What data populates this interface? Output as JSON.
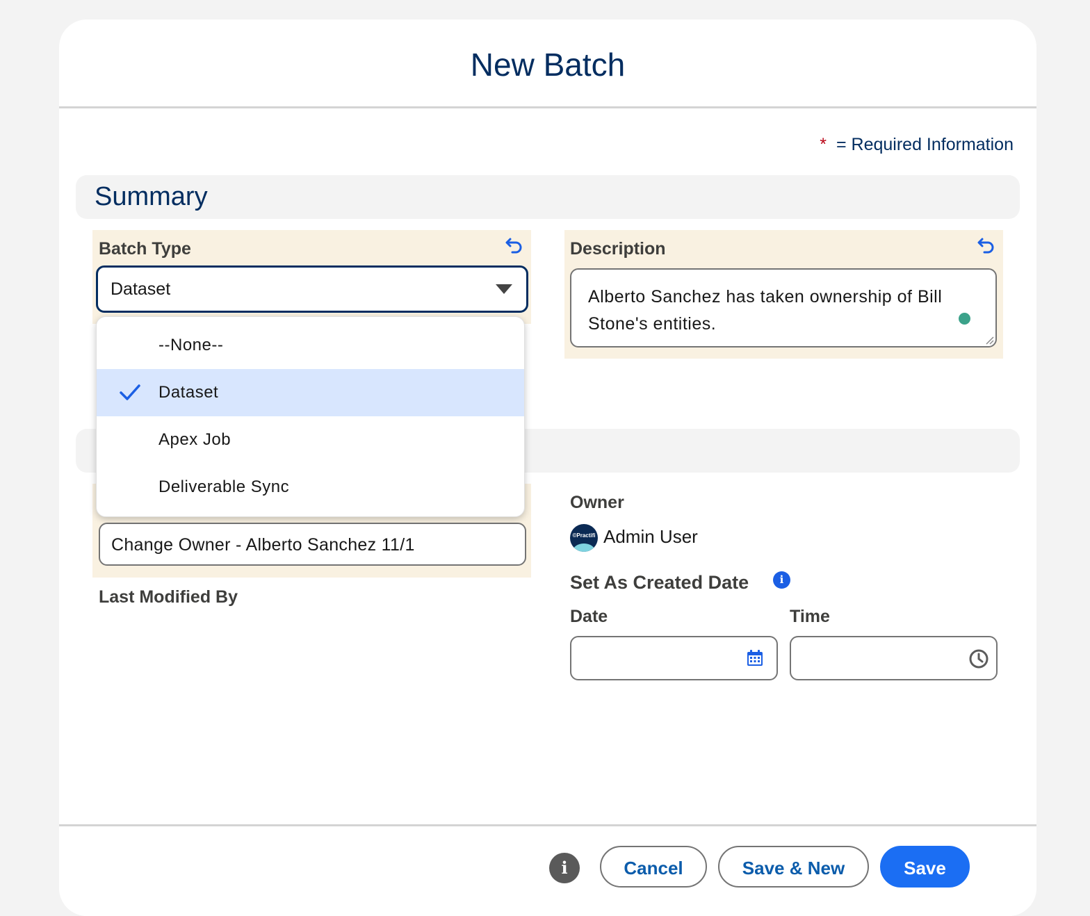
{
  "modal": {
    "title": "New Batch",
    "required_note": {
      "asterisk": "*",
      "text": "= Required Information"
    }
  },
  "summary_section": {
    "title": "Summary",
    "batch_type": {
      "label": "Batch Type",
      "value": "Dataset",
      "options": [
        "--None--",
        "Dataset",
        "Apex Job",
        "Deliverable Sync"
      ],
      "selected_option": "Dataset"
    },
    "description": {
      "label": "Description",
      "value": "Alberto Sanchez has taken ownership of Bill Stone's entities."
    }
  },
  "system_section": {
    "batch_name": {
      "value": "Change Owner - Alberto Sanchez 11/1"
    },
    "last_modified_by": {
      "label": "Last Modified By"
    },
    "owner": {
      "label": "Owner",
      "name": "Admin User",
      "avatar_text": "©Practifi"
    },
    "set_as_created_date": {
      "label": "Set As Created Date",
      "date_label": "Date",
      "time_label": "Time"
    }
  },
  "footer": {
    "cancel_label": "Cancel",
    "save_new_label": "Save & New",
    "save_label": "Save"
  },
  "colors": {
    "brand": "#1b6ef3",
    "title": "#032d60",
    "highlight": "#f9f1e1",
    "selected_option": "#d8e6fe"
  },
  "icons": [
    "undo-icon",
    "chevron-down-icon",
    "check-icon",
    "calendar-icon",
    "clock-icon",
    "info-icon"
  ]
}
